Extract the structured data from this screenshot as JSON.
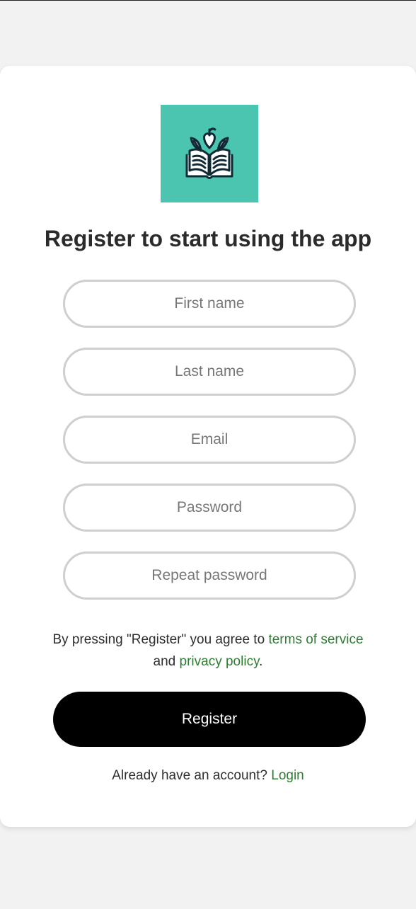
{
  "logo": {
    "icon": "open-book-with-leaves-icon",
    "background": "#4cc5b0"
  },
  "title": "Register to start using the app",
  "fields": [
    {
      "name": "first-name-input",
      "placeholder": "First name",
      "value": ""
    },
    {
      "name": "last-name-input",
      "placeholder": "Last name",
      "value": ""
    },
    {
      "name": "email-input",
      "placeholder": "Email",
      "value": ""
    },
    {
      "name": "password-input",
      "placeholder": "Password",
      "value": ""
    },
    {
      "name": "repeat-password-input",
      "placeholder": "Repeat password",
      "value": ""
    }
  ],
  "agreement": {
    "prefix": "By pressing \"Register\" you agree to ",
    "terms_link": "terms of service",
    "conjunction": "and ",
    "privacy_link": "privacy policy",
    "suffix": "."
  },
  "register_button": "Register",
  "login": {
    "prompt": "Already have an account? ",
    "link": "Login"
  },
  "colors": {
    "page_background": "#f2f2f2",
    "card_background": "#ffffff",
    "link": "#2e7d32",
    "button": "#000000",
    "field_border": "#cfcfcf"
  }
}
